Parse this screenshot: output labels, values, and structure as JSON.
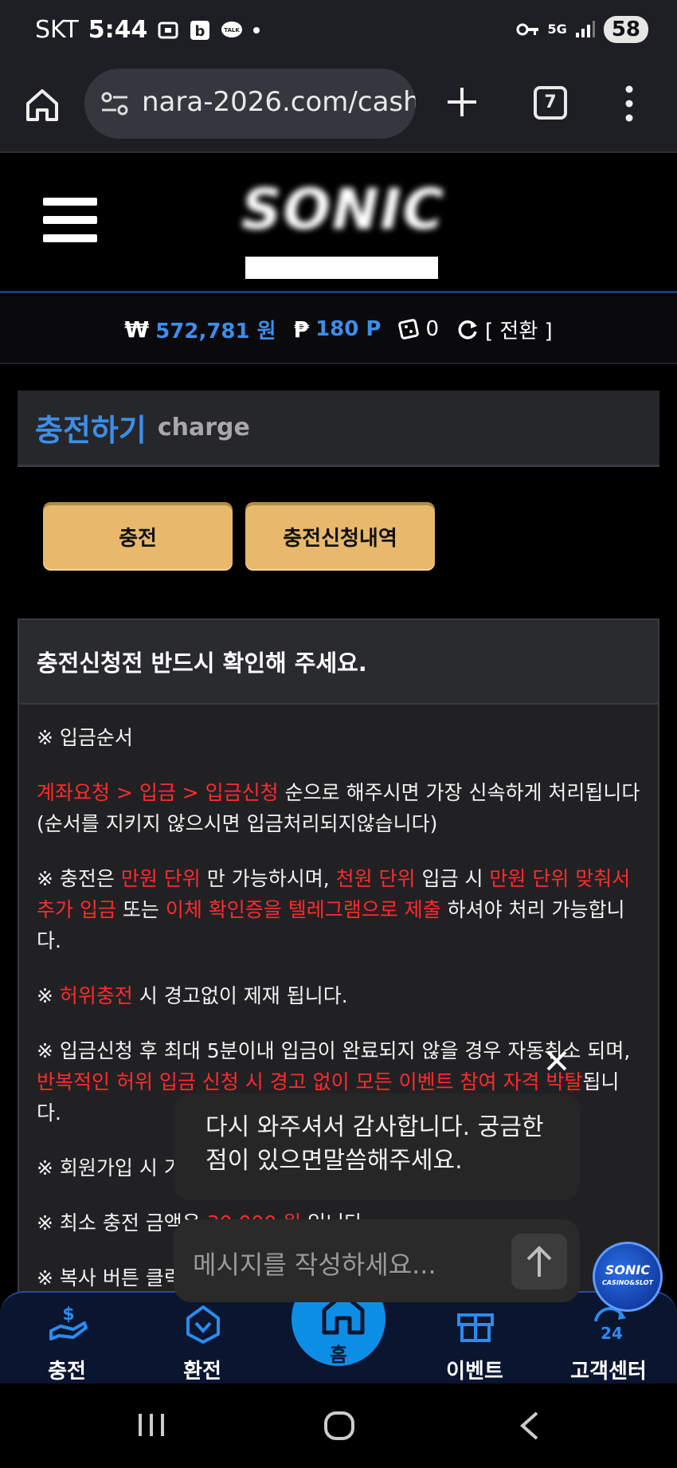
{
  "status_bar": {
    "carrier": "SKT",
    "time": "5:44",
    "network": "5G",
    "battery": "58"
  },
  "browser": {
    "url": "nara-2026.com/cash",
    "tab_count": "7"
  },
  "site": {
    "logo_text": "SONIC"
  },
  "balance": {
    "won_symbol": "₩",
    "won_value": "572,781 원",
    "point_symbol": "₱",
    "point_value": "180 P",
    "ticket_value": "0",
    "switch_label": "[ 전환 ]"
  },
  "page": {
    "title": "충전하기",
    "subtitle": "charge"
  },
  "buttons": {
    "charge": "충전",
    "history": "충전신청내역"
  },
  "notice": {
    "heading": "충전신청전 반드시 확인해 주세요.",
    "order_label": "※ 입금순서",
    "p1_red": "계좌요청 > 입금 > 입금신청",
    "p1_rest": " 순으로 해주시면 가장 신속하게 처리됩니다(순서를 지키지 않으시면 입금처리되지않습니다)",
    "p2_a": "※ 충전은 ",
    "p2_b": "만원 단위",
    "p2_c": " 만 가능하시며, ",
    "p2_d": "천원 단위",
    "p2_e": " 입금 시 ",
    "p2_f": "만원 단위 맞춰서 추가 입금",
    "p2_g": " 또는 ",
    "p2_h": "이체 확인증을 텔레그램으로 제출",
    "p2_i": " 하셔야 처리 가능합니다.",
    "p3_a": "※ ",
    "p3_b": "허위충전",
    "p3_c": " 시 경고없이 제재 됩니다.",
    "p4_a": "※ 입금신청 후 최대 5분이내 입금이 완료되지 않을 경우 자동취소 되며, ",
    "p4_b": "반복적인 허위 입금 신청 시 경고 없이 모든 이벤트 참여 자격 박탈",
    "p4_c": "됩니다.",
    "p5": "※ 회원가입 시 기",
    "p6_a": "※ 최소 충전 금액은 ",
    "p6_b": "30,000 원",
    "p6_c": " 입니다.",
    "p7": "※ 복사 버튼 클릭"
  },
  "chat": {
    "message": "다시 와주셔서 감사합니다. 궁금한점이 있으면말씀해주세요.",
    "input_placeholder": "메시지를 작성하세요...",
    "avatar_text": "SONIC",
    "avatar_sub": "CASINO&SLOT"
  },
  "bottom_nav": {
    "charge": "충전",
    "exchange": "환전",
    "home": "홈",
    "event": "이벤트",
    "support": "고객센터"
  },
  "colors": {
    "accent_blue": "#3d8ee8",
    "button_gold": "#e8b86c",
    "warning_red": "#ff2b2b",
    "nav_bg": "#0a1530"
  }
}
